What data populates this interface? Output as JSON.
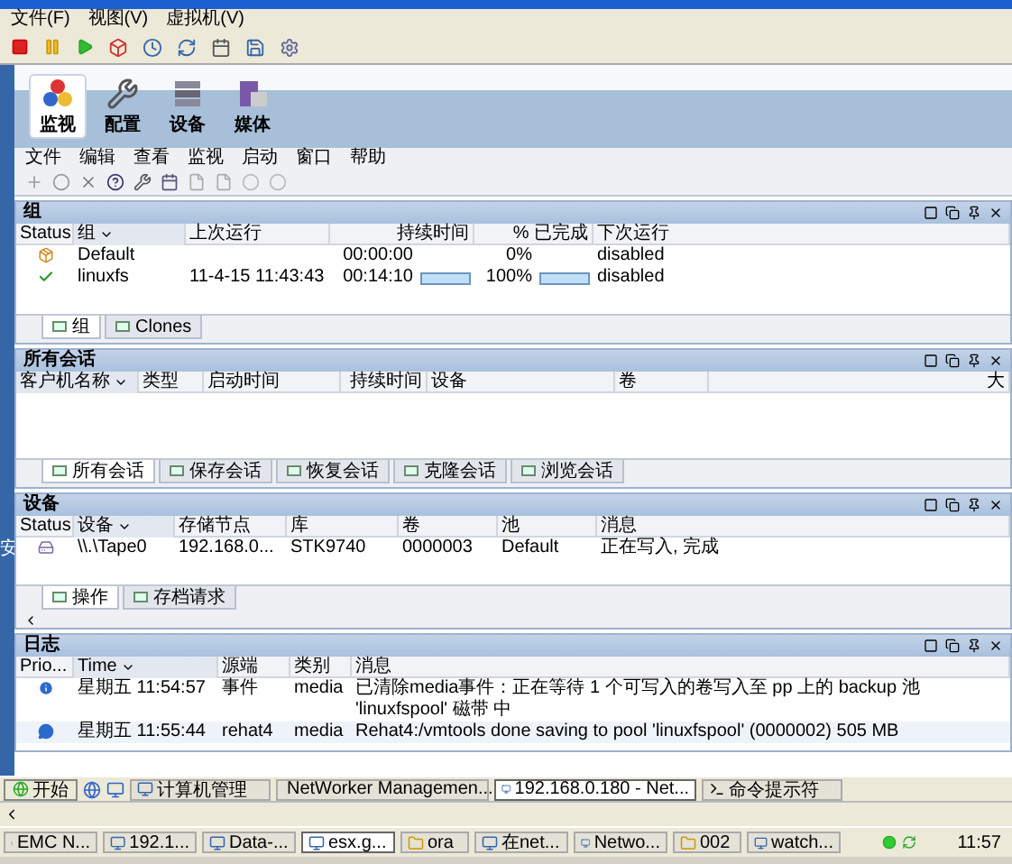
{
  "window": {
    "menu": [
      "文件(F)",
      "视图(V)",
      "虚拟机(V)"
    ]
  },
  "nav": [
    {
      "label": "监视",
      "kind": "monitor",
      "selected": true
    },
    {
      "label": "配置",
      "kind": "config",
      "selected": false
    },
    {
      "label": "设备",
      "kind": "devices",
      "selected": false
    },
    {
      "label": "媒体",
      "kind": "media",
      "selected": false
    }
  ],
  "app_menu": [
    "文件",
    "编辑",
    "查看",
    "监视",
    "启动",
    "窗口",
    "帮助"
  ],
  "groups": {
    "title": "组",
    "columns": [
      {
        "label": "Status",
        "sorted": false
      },
      {
        "label": "组",
        "sorted": true
      },
      {
        "label": "上次运行",
        "sorted": false
      },
      {
        "label": "持续时间",
        "sorted": false
      },
      {
        "label": "% 已完成",
        "sorted": false
      },
      {
        "label": "下次运行",
        "sorted": false
      }
    ],
    "rows": [
      {
        "kind": "idle",
        "name": "Default",
        "duration": "00:00:00",
        "percent": "0%",
        "next_run": "disabled"
      },
      {
        "kind": "success",
        "name": "linuxfs",
        "last_run": "11-4-15 11:43:43",
        "duration": "00:14:10",
        "duration_bar": {
          "level": 1
        },
        "percent": "100%",
        "percent_bar": {
          "level": 1
        },
        "next_run": "disabled"
      }
    ],
    "tabs": [
      {
        "label": "组",
        "selected": true
      },
      {
        "label": "Clones",
        "selected": false
      }
    ]
  },
  "side_label": "安",
  "sessions": {
    "title": "所有会话",
    "columns": [
      {
        "label": "客户机名称",
        "sorted": true
      },
      {
        "label": "类型",
        "sorted": false
      },
      {
        "label": "启动时间",
        "sorted": false
      },
      {
        "label": "持续时间",
        "sorted": false
      },
      {
        "label": "设备",
        "sorted": false
      },
      {
        "label": "卷",
        "sorted": false
      },
      {
        "label": "大",
        "sorted": false
      }
    ],
    "tabs": [
      {
        "label": "所有会话",
        "selected": true
      },
      {
        "label": "保存会话",
        "selected": false
      },
      {
        "label": "恢复会话",
        "selected": false
      },
      {
        "label": "克隆会话",
        "selected": false
      },
      {
        "label": "浏览会话",
        "selected": false
      }
    ]
  },
  "devices": {
    "title": "设备",
    "columns": [
      {
        "label": "Status",
        "sorted": false
      },
      {
        "label": "设备",
        "sorted": true
      },
      {
        "label": "存储节点",
        "sorted": false
      },
      {
        "label": "库",
        "sorted": false
      },
      {
        "label": "卷",
        "sorted": false
      },
      {
        "label": "池",
        "sorted": false
      },
      {
        "label": "消息",
        "sorted": false
      }
    ],
    "rows": [
      {
        "kind": "tape",
        "device": "\\\\.\\Tape0",
        "storage_node": "192.168.0...",
        "library": "STK9740",
        "volume": "0000003",
        "pool": "Default",
        "message": "正在写入, 完成"
      }
    ]
  },
  "devices_tabs": [
    {
      "label": "操作",
      "selected": true
    },
    {
      "label": "存档请求",
      "selected": false
    }
  ],
  "log": {
    "title": "日志",
    "columns": [
      {
        "label": "Prio...",
        "sorted": false
      },
      {
        "label": "Time",
        "sorted": true
      },
      {
        "label": "源端",
        "sorted": false
      },
      {
        "label": "类别",
        "sorted": false
      },
      {
        "label": "消息",
        "sorted": false
      }
    ],
    "rows": [
      {
        "kind": "info",
        "time": "星期五 11:54:57",
        "source": "事件",
        "category": "media",
        "message": "已清除media事件：正在等待 1 个可写入的卷写入至 pp 上的 backup 池 'linuxfspool' 磁带 中"
      },
      {
        "kind": "message",
        "time": "星期五 11:55:44",
        "source": "rehat4",
        "category": "media",
        "message": "Rehat4:/vmtools done saving to pool 'linuxfspool' (0000002) 505 MB"
      }
    ]
  },
  "taskbar": {
    "start": "开始",
    "tasks": [
      {
        "label": "计算机管理",
        "selected": false
      },
      {
        "label": "NetWorker Managemen...",
        "selected": false
      },
      {
        "label": "192.168.0.180 - Net...",
        "selected": true
      },
      {
        "label": "命令提示符",
        "selected": false
      }
    ]
  },
  "taskbar_2": {
    "tasks": [
      {
        "label": "EMC N...",
        "selected": false
      },
      {
        "label": "192.1...",
        "selected": false
      },
      {
        "label": "Data-...",
        "selected": false
      },
      {
        "label": "esx.g...",
        "selected": true
      },
      {
        "label": "ora",
        "selected": false
      },
      {
        "label": "在net...",
        "selected": false
      },
      {
        "label": "Netwo...",
        "selected": false
      },
      {
        "label": "002",
        "selected": false
      },
      {
        "label": "watch...",
        "selected": false
      }
    ],
    "clock": "11:57"
  }
}
